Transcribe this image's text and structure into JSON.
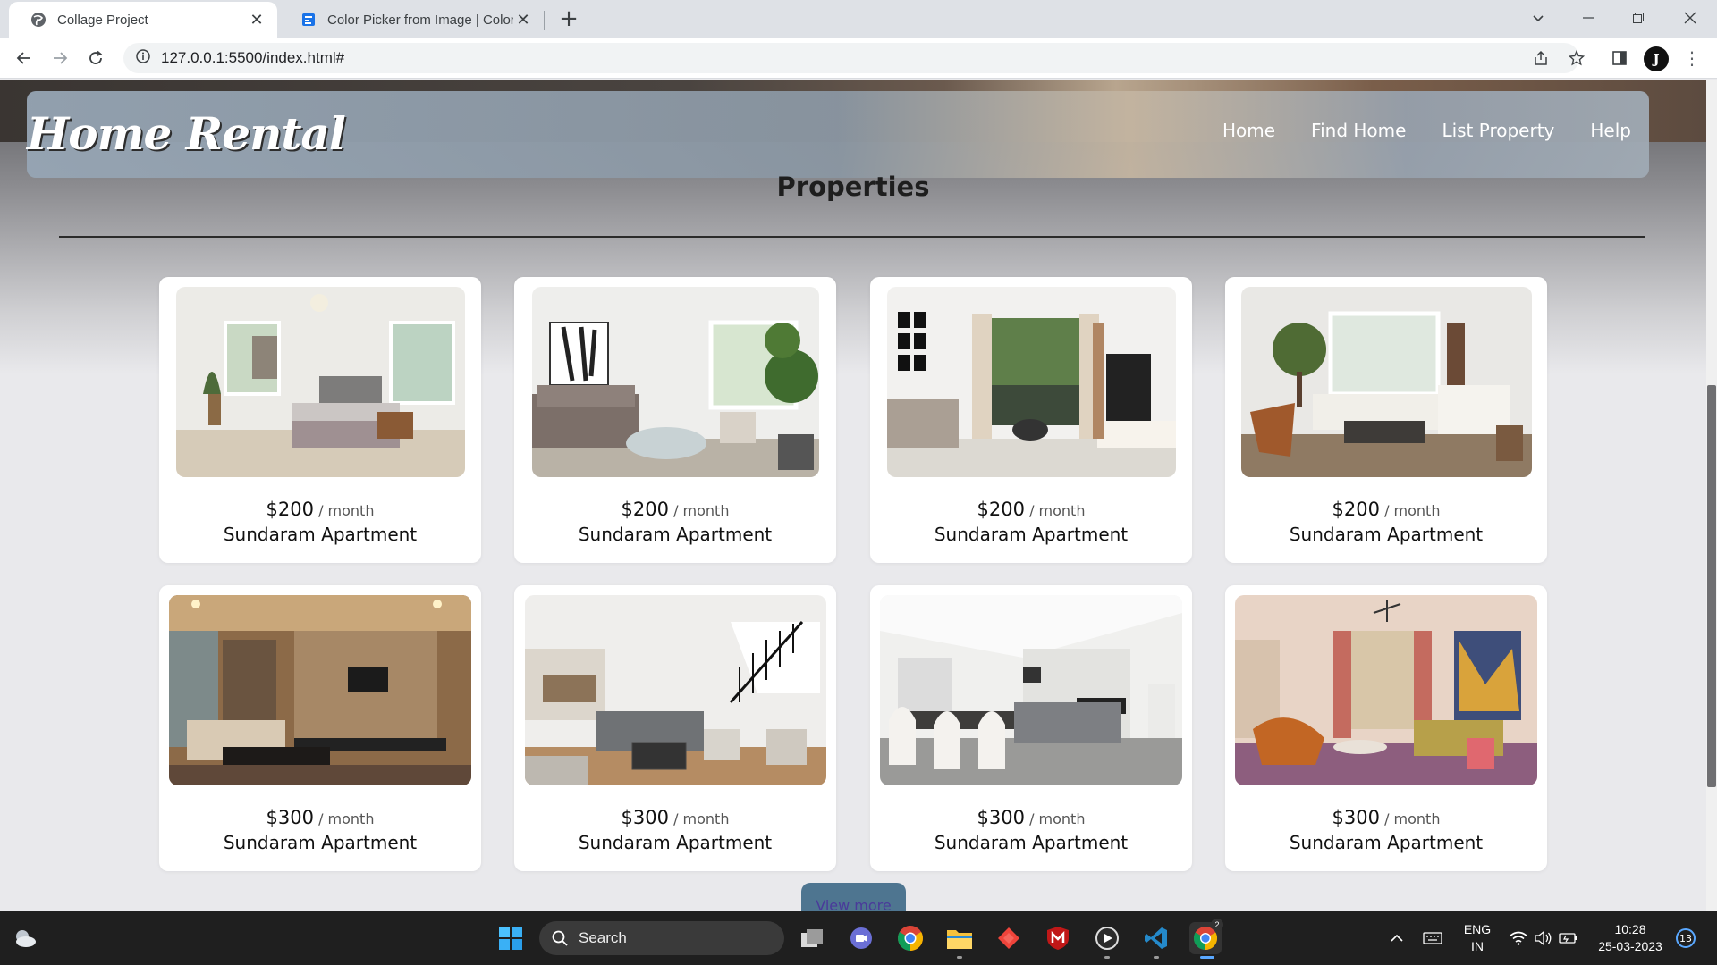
{
  "browser": {
    "tabs": [
      {
        "title": "Collage Project",
        "active": true,
        "favicon": "globe-icon"
      },
      {
        "title": "Color Picker from Image | Color Picker",
        "active": false,
        "favicon": "color-picker-favicon"
      }
    ],
    "url": "127.0.0.1:5500/index.html#",
    "profile_initial": "J"
  },
  "site": {
    "logo": "Home Rental",
    "nav": [
      "Home",
      "Find Home",
      "List Property",
      "Help"
    ],
    "section_title": "Properties",
    "listings": [
      {
        "price": "$200",
        "period": "/ month",
        "name": "Sundaram Apartment",
        "image": "bedroom"
      },
      {
        "price": "$200",
        "period": "/ month",
        "name": "Sundaram Apartment",
        "image": "living-room-bright"
      },
      {
        "price": "$200",
        "period": "/ month",
        "name": "Sundaram Apartment",
        "image": "living-room-tv"
      },
      {
        "price": "$200",
        "period": "/ month",
        "name": "Sundaram Apartment",
        "image": "living-room-sectional"
      },
      {
        "price": "$300",
        "period": "/ month",
        "name": "Sundaram Apartment",
        "image": "living-room-warm-lights"
      },
      {
        "price": "$300",
        "period": "/ month",
        "name": "Sundaram Apartment",
        "image": "open-plan-staircase"
      },
      {
        "price": "$300",
        "period": "/ month",
        "name": "Sundaram Apartment",
        "image": "dining-living"
      },
      {
        "price": "$300",
        "period": "/ month",
        "name": "Sundaram Apartment",
        "image": "colorful-lounge"
      }
    ],
    "view_more": "View more"
  },
  "taskbar": {
    "search_label": "Search",
    "language": "ENG",
    "region": "IN",
    "time": "10:28",
    "date": "25-03-2023",
    "notification_count": "13",
    "chrome_badge": "2"
  },
  "colors": {
    "accent_button": "#4e7590",
    "taskbar": "#1f1f1f"
  }
}
